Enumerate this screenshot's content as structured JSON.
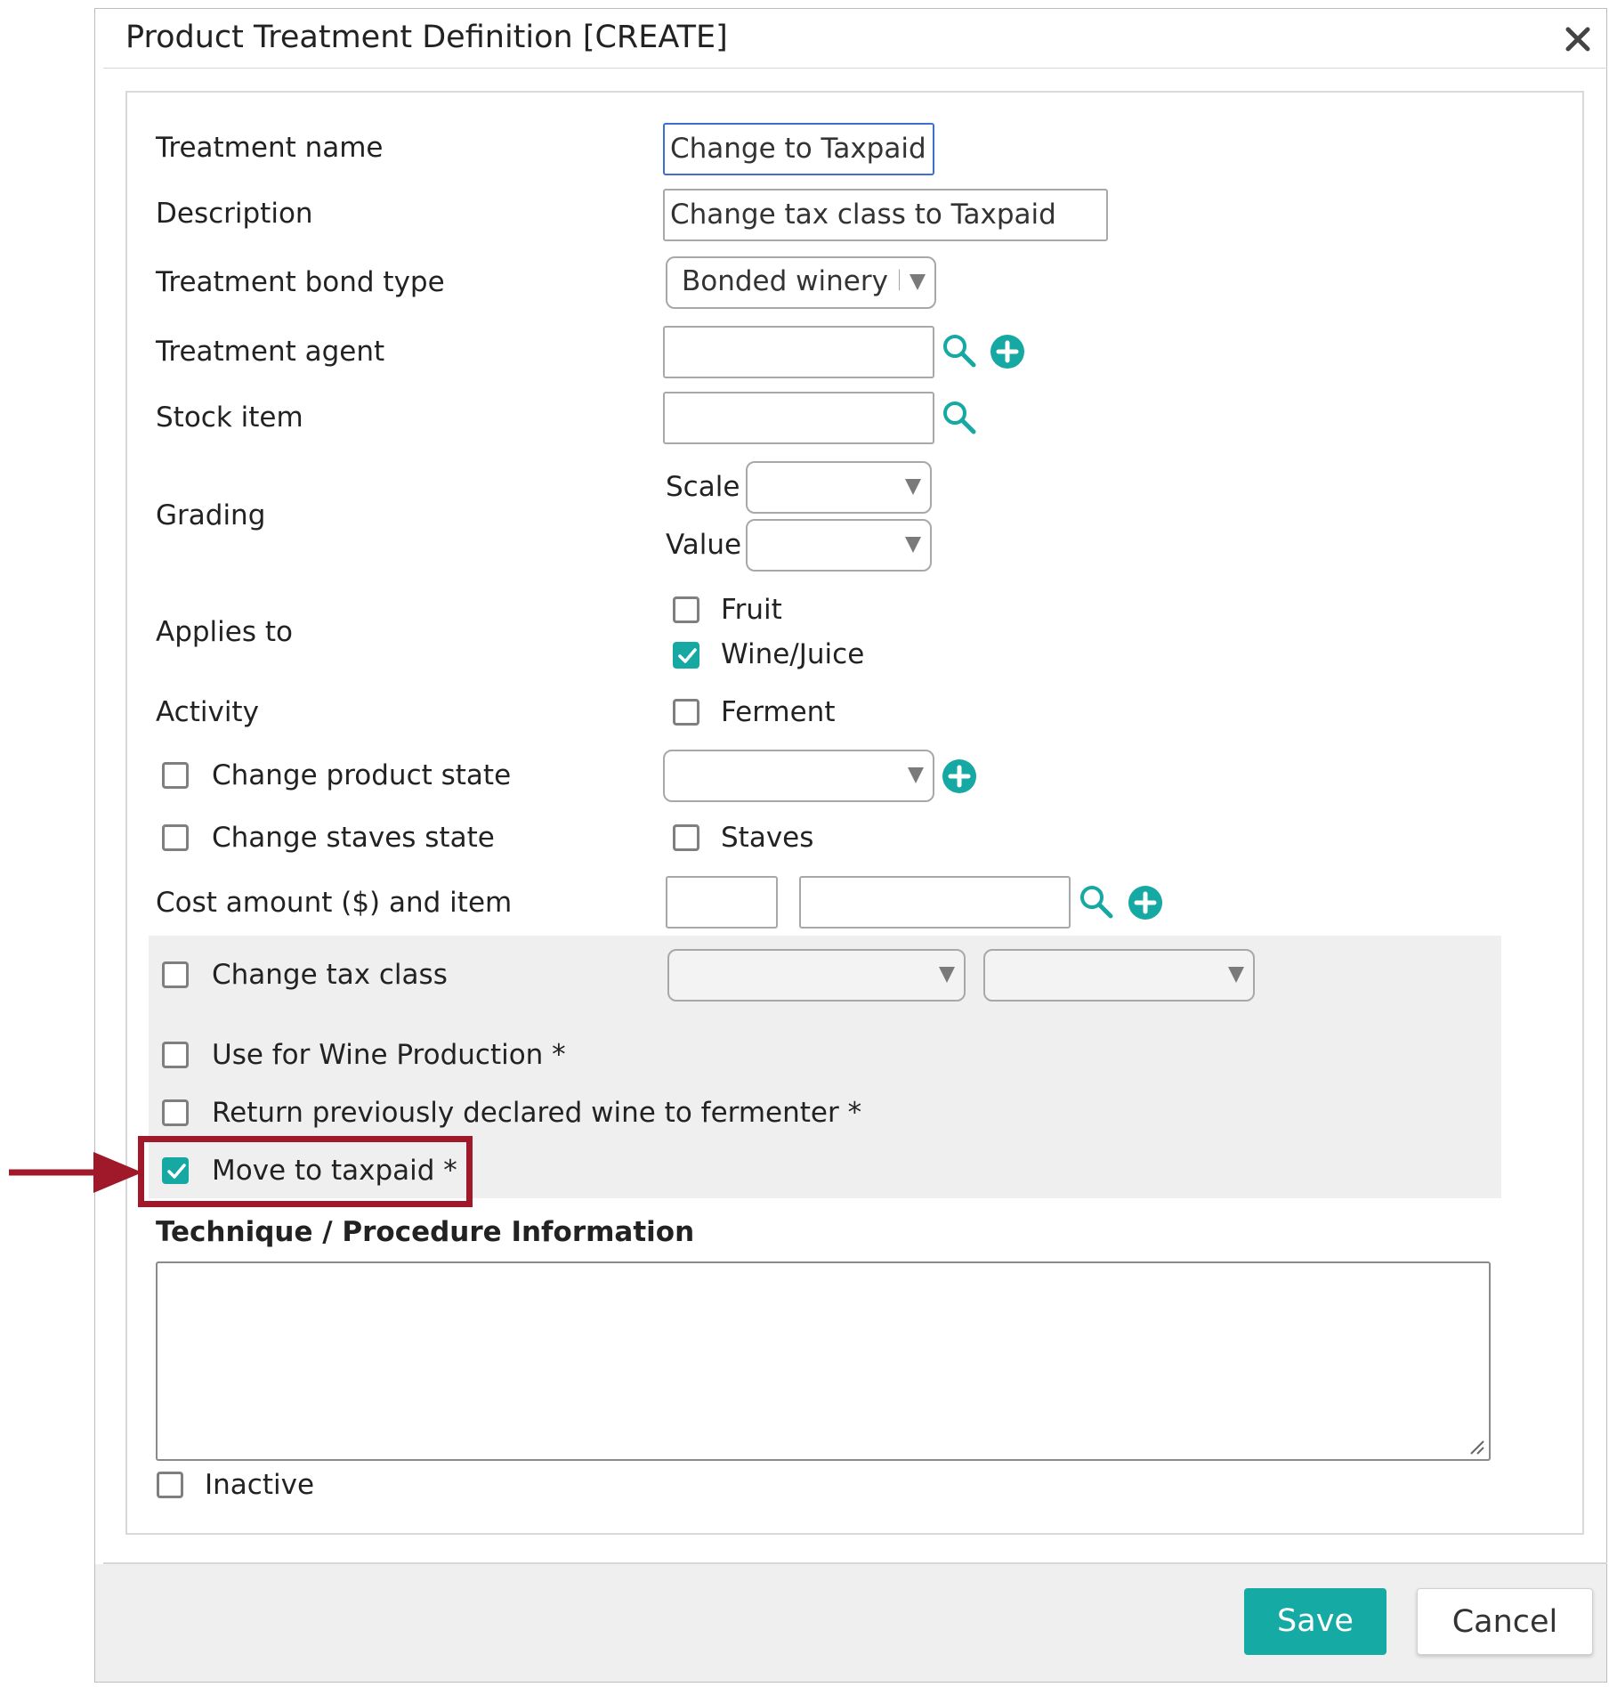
{
  "dialog": {
    "title": "Product Treatment Definition [CREATE]",
    "close_icon": "close-icon"
  },
  "form": {
    "treatment_name": {
      "label": "Treatment name",
      "value": "Change to Taxpaid"
    },
    "description": {
      "label": "Description",
      "value": "Change tax class to Taxpaid"
    },
    "bond_type": {
      "label": "Treatment bond type",
      "value": "Bonded winery b"
    },
    "agent": {
      "label": "Treatment agent",
      "value": ""
    },
    "stock_item": {
      "label": "Stock item",
      "value": ""
    },
    "grading": {
      "label": "Grading",
      "scale_label": "Scale",
      "scale_value": "",
      "value_label": "Value",
      "value_value": ""
    },
    "applies_to": {
      "label": "Applies to",
      "options": [
        {
          "label": "Fruit",
          "checked": false
        },
        {
          "label": "Wine/Juice",
          "checked": true
        }
      ]
    },
    "activity": {
      "label": "Activity",
      "ferment_label": "Ferment",
      "ferment_checked": false
    },
    "change_product_state": {
      "label": "Change product state",
      "checked": false,
      "value": ""
    },
    "change_staves_state": {
      "label": "Change staves state",
      "checked": false,
      "staves_label": "Staves",
      "staves_checked": false
    },
    "cost": {
      "label": "Cost amount ($) and item",
      "amount": "",
      "item": ""
    },
    "change_tax_class": {
      "label": "Change tax class",
      "checked": false,
      "from": "",
      "to": ""
    },
    "use_for_wine_production": {
      "label": "Use for Wine Production *",
      "checked": false
    },
    "return_to_fermenter": {
      "label": "Return previously declared wine to fermenter *",
      "checked": false
    },
    "move_to_taxpaid": {
      "label": "Move to taxpaid *",
      "checked": true
    },
    "technique": {
      "label": "Technique / Procedure Information",
      "value": ""
    },
    "inactive": {
      "label": "Inactive",
      "checked": false
    }
  },
  "buttons": {
    "save": "Save",
    "cancel": "Cancel"
  },
  "colors": {
    "accent": "#16a8a2",
    "highlight": "#a0192b",
    "focus_border": "#3d6fd1"
  }
}
